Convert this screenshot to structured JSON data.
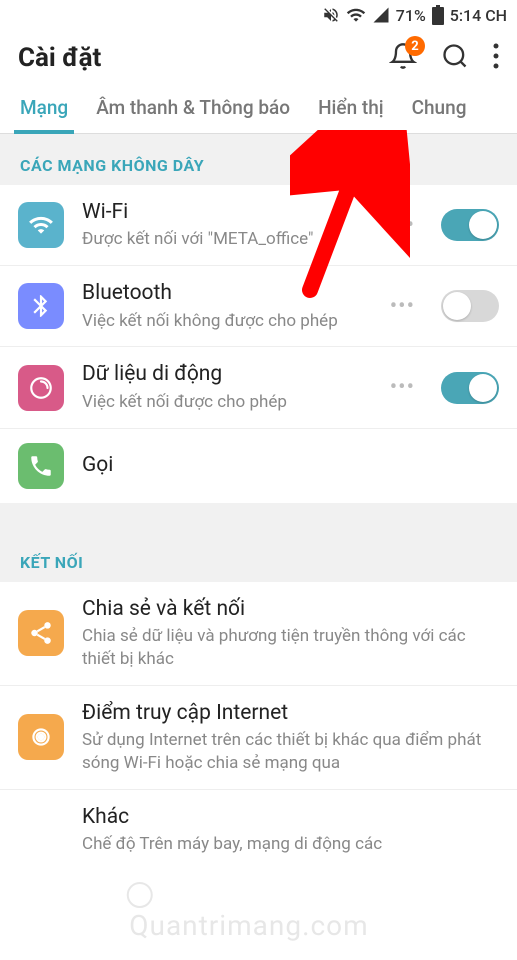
{
  "status_bar": {
    "battery": "71%",
    "time": "5:14 CH"
  },
  "header": {
    "title": "Cài đặt",
    "badge_count": "2"
  },
  "tabs": [
    {
      "label": "Mạng"
    },
    {
      "label": "Âm thanh & Thông báo"
    },
    {
      "label": "Hiển thị"
    },
    {
      "label": "Chung"
    }
  ],
  "sections": {
    "wireless": {
      "header": "CÁC MẠNG KHÔNG DÂY",
      "items": {
        "wifi": {
          "title": "Wi-Fi",
          "sub": "Được kết nối với \"META_office\""
        },
        "bt": {
          "title": "Bluetooth",
          "sub": "Việc kết nối không được cho phép"
        },
        "data": {
          "title": "Dữ liệu di động",
          "sub": "Việc kết nối được cho phép"
        },
        "call": {
          "title": "Gọi"
        }
      }
    },
    "connect": {
      "header": "KẾT NỐI",
      "items": {
        "share": {
          "title": "Chia sẻ và kết nối",
          "sub": "Chia sẻ dữ liệu và phương tiện truyền thông với các thiết bị khác"
        },
        "hotspot": {
          "title": "Điểm truy cập Internet",
          "sub": "Sử dụng Internet trên các thiết bị khác qua điểm phát sóng Wi-Fi hoặc chia sẻ mạng qua"
        },
        "other": {
          "title": "Khác",
          "sub": "Chế độ Trên máy bay, mạng di động các"
        }
      }
    }
  },
  "watermark": "Quantrimang.com"
}
